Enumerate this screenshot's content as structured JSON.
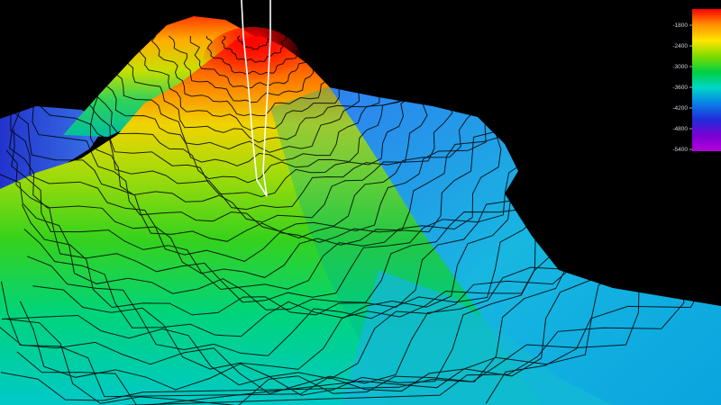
{
  "view": {
    "type": "3d bathymetry render",
    "background": "#000000",
    "contour_color": "#000000",
    "track_line_color": "#ffffff"
  },
  "colorbar": {
    "tick_labels": [
      "-1800",
      "-2400",
      "-3000",
      "-3600",
      "-4200",
      "-4800",
      "-5400"
    ],
    "tick_values": [
      -1800,
      -2400,
      -3000,
      -3600,
      -4200,
      -4800,
      -5400
    ],
    "range": [
      -5600,
      -1450
    ],
    "colors": [
      "#ff0000",
      "#ff9100",
      "#ffe400",
      "#7fdc00",
      "#00cf44",
      "#00d6c9",
      "#0a7ee8",
      "#1f2cd8",
      "#7a00d4",
      "#b400d8"
    ]
  }
}
